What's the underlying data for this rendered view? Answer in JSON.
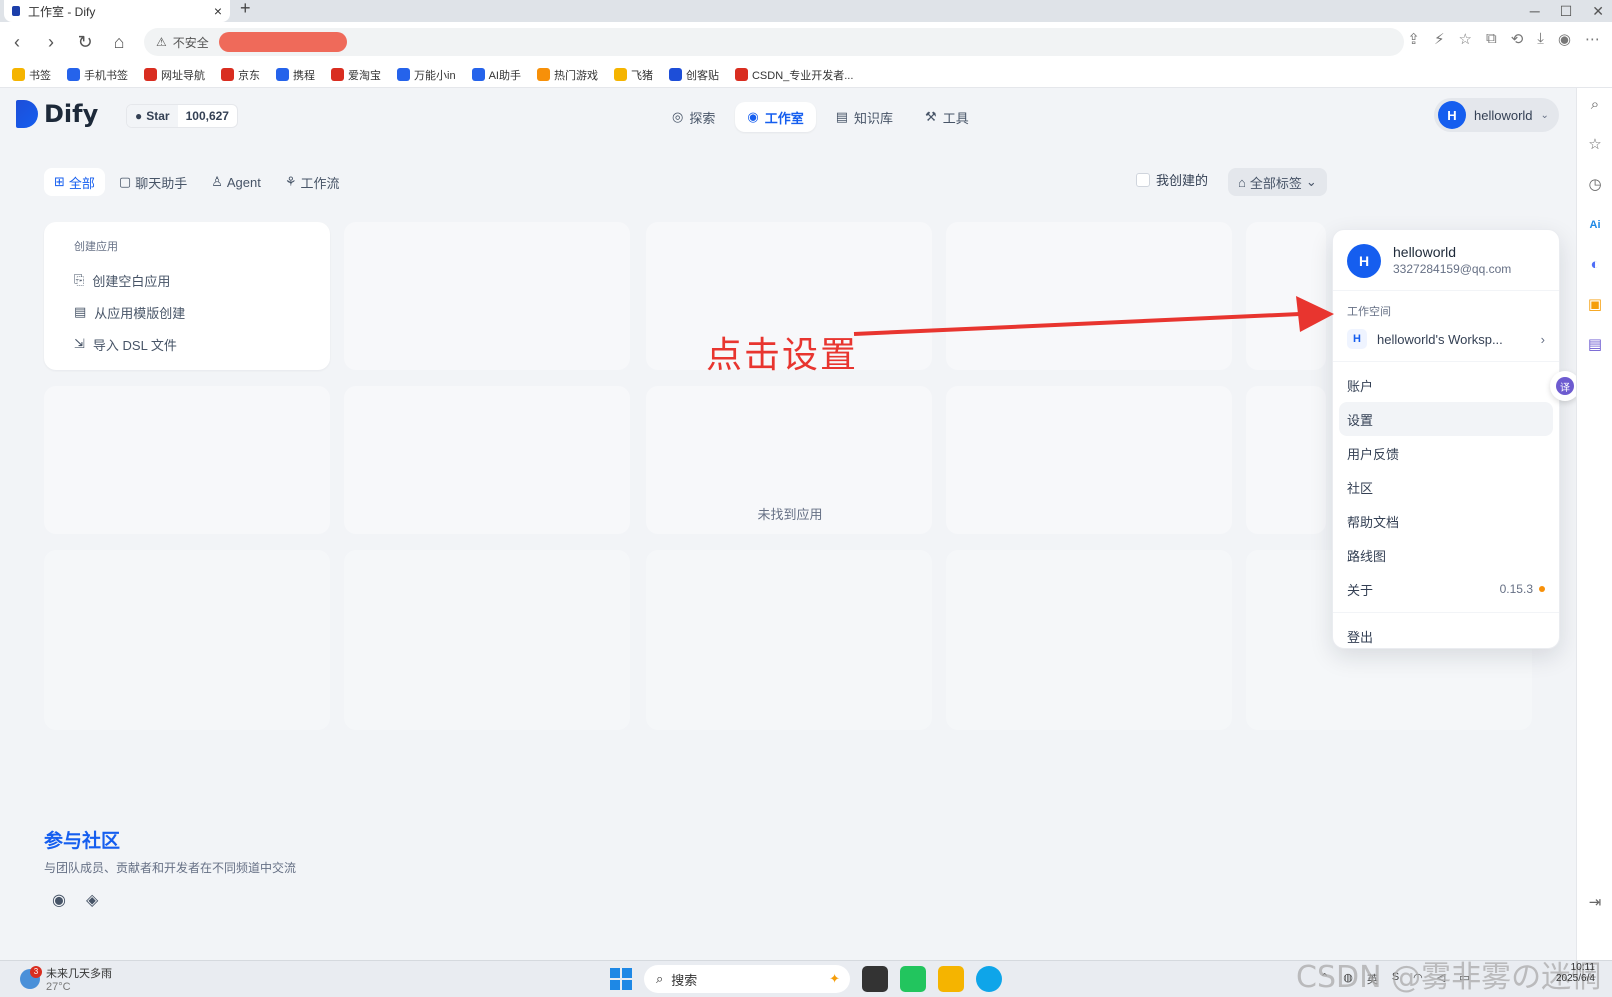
{
  "browser": {
    "tab_title": "工作室 - Dify",
    "new_tab": "+",
    "close": "×",
    "security_label": "不安全",
    "bookmarks": [
      {
        "label": "书签",
        "color": "#f5b400"
      },
      {
        "label": "手机书签",
        "color": "#2563eb"
      },
      {
        "label": "网址导航",
        "color": "#d92d20"
      },
      {
        "label": "京东",
        "color": "#d92d20"
      },
      {
        "label": "携程",
        "color": "#2563eb"
      },
      {
        "label": "爱淘宝",
        "color": "#d92d20"
      },
      {
        "label": "万能小in",
        "color": "#2563eb"
      },
      {
        "label": "AI助手",
        "color": "#2563eb"
      },
      {
        "label": "热门游戏",
        "color": "#f79009"
      },
      {
        "label": "飞猪",
        "color": "#f5b400"
      },
      {
        "label": "创客贴",
        "color": "#1d4ed8"
      },
      {
        "label": "CSDN_专业开发者...",
        "color": "#d92d20"
      }
    ]
  },
  "header": {
    "logo": "Dify",
    "github_star": "Star",
    "github_count": "100,627",
    "nav": [
      {
        "label": "探索",
        "icon": "compass-icon",
        "active": false
      },
      {
        "label": "工作室",
        "icon": "robot-icon",
        "active": true
      },
      {
        "label": "知识库",
        "icon": "book-icon",
        "active": false
      },
      {
        "label": "工具",
        "icon": "tool-icon",
        "active": false
      }
    ],
    "user_initial": "H",
    "user_name": "helloworld"
  },
  "filters": {
    "tabs": [
      {
        "label": "全部",
        "icon": "grid-icon",
        "active": true
      },
      {
        "label": "聊天助手",
        "icon": "chat-icon",
        "active": false
      },
      {
        "label": "Agent",
        "icon": "agent-icon",
        "active": false
      },
      {
        "label": "工作流",
        "icon": "workflow-icon",
        "active": false
      }
    ],
    "mine_label": "我创建的",
    "tags_label": "全部标签"
  },
  "create_card": {
    "heading": "创建应用",
    "items": [
      {
        "label": "创建空白应用",
        "icon": "file-plus-icon"
      },
      {
        "label": "从应用模版创建",
        "icon": "template-icon"
      },
      {
        "label": "导入 DSL 文件",
        "icon": "import-icon"
      }
    ]
  },
  "empty_text": "未找到应用",
  "annotation": {
    "text": "点击设置",
    "color": "#e8352f"
  },
  "community": {
    "title": "参与社区",
    "desc": "与团队成员、贡献者和开发者在不同频道中交流"
  },
  "dropdown": {
    "name": "helloworld",
    "email": "3327284159@qq.com",
    "workspace_label": "工作空间",
    "workspace_name": "helloworld's Worksp...",
    "items": [
      "账户",
      "设置",
      "用户反馈",
      "社区",
      "帮助文档",
      "路线图"
    ],
    "about_label": "关于",
    "version": "0.15.3",
    "logout": "登出"
  },
  "taskbar": {
    "weather_title": "未来几天多雨",
    "weather_temp": "27°C",
    "weather_badge": "3",
    "search": "搜索",
    "time": "10:11",
    "date": "2025/6/4"
  },
  "watermark": "CSDN @雾非雾の迷惘",
  "colors": {
    "accent": "#155eef"
  }
}
